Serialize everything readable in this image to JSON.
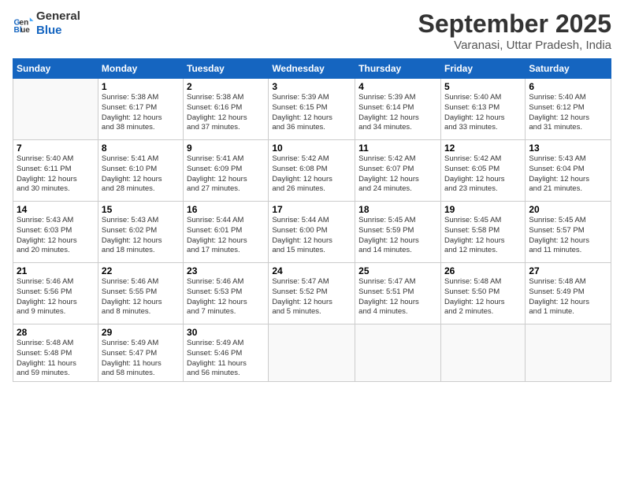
{
  "header": {
    "logo_line1": "General",
    "logo_line2": "Blue",
    "month": "September 2025",
    "location": "Varanasi, Uttar Pradesh, India"
  },
  "days_of_week": [
    "Sunday",
    "Monday",
    "Tuesday",
    "Wednesday",
    "Thursday",
    "Friday",
    "Saturday"
  ],
  "weeks": [
    [
      {
        "num": "",
        "info": ""
      },
      {
        "num": "1",
        "info": "Sunrise: 5:38 AM\nSunset: 6:17 PM\nDaylight: 12 hours\nand 38 minutes."
      },
      {
        "num": "2",
        "info": "Sunrise: 5:38 AM\nSunset: 6:16 PM\nDaylight: 12 hours\nand 37 minutes."
      },
      {
        "num": "3",
        "info": "Sunrise: 5:39 AM\nSunset: 6:15 PM\nDaylight: 12 hours\nand 36 minutes."
      },
      {
        "num": "4",
        "info": "Sunrise: 5:39 AM\nSunset: 6:14 PM\nDaylight: 12 hours\nand 34 minutes."
      },
      {
        "num": "5",
        "info": "Sunrise: 5:40 AM\nSunset: 6:13 PM\nDaylight: 12 hours\nand 33 minutes."
      },
      {
        "num": "6",
        "info": "Sunrise: 5:40 AM\nSunset: 6:12 PM\nDaylight: 12 hours\nand 31 minutes."
      }
    ],
    [
      {
        "num": "7",
        "info": "Sunrise: 5:40 AM\nSunset: 6:11 PM\nDaylight: 12 hours\nand 30 minutes."
      },
      {
        "num": "8",
        "info": "Sunrise: 5:41 AM\nSunset: 6:10 PM\nDaylight: 12 hours\nand 28 minutes."
      },
      {
        "num": "9",
        "info": "Sunrise: 5:41 AM\nSunset: 6:09 PM\nDaylight: 12 hours\nand 27 minutes."
      },
      {
        "num": "10",
        "info": "Sunrise: 5:42 AM\nSunset: 6:08 PM\nDaylight: 12 hours\nand 26 minutes."
      },
      {
        "num": "11",
        "info": "Sunrise: 5:42 AM\nSunset: 6:07 PM\nDaylight: 12 hours\nand 24 minutes."
      },
      {
        "num": "12",
        "info": "Sunrise: 5:42 AM\nSunset: 6:05 PM\nDaylight: 12 hours\nand 23 minutes."
      },
      {
        "num": "13",
        "info": "Sunrise: 5:43 AM\nSunset: 6:04 PM\nDaylight: 12 hours\nand 21 minutes."
      }
    ],
    [
      {
        "num": "14",
        "info": "Sunrise: 5:43 AM\nSunset: 6:03 PM\nDaylight: 12 hours\nand 20 minutes."
      },
      {
        "num": "15",
        "info": "Sunrise: 5:43 AM\nSunset: 6:02 PM\nDaylight: 12 hours\nand 18 minutes."
      },
      {
        "num": "16",
        "info": "Sunrise: 5:44 AM\nSunset: 6:01 PM\nDaylight: 12 hours\nand 17 minutes."
      },
      {
        "num": "17",
        "info": "Sunrise: 5:44 AM\nSunset: 6:00 PM\nDaylight: 12 hours\nand 15 minutes."
      },
      {
        "num": "18",
        "info": "Sunrise: 5:45 AM\nSunset: 5:59 PM\nDaylight: 12 hours\nand 14 minutes."
      },
      {
        "num": "19",
        "info": "Sunrise: 5:45 AM\nSunset: 5:58 PM\nDaylight: 12 hours\nand 12 minutes."
      },
      {
        "num": "20",
        "info": "Sunrise: 5:45 AM\nSunset: 5:57 PM\nDaylight: 12 hours\nand 11 minutes."
      }
    ],
    [
      {
        "num": "21",
        "info": "Sunrise: 5:46 AM\nSunset: 5:56 PM\nDaylight: 12 hours\nand 9 minutes."
      },
      {
        "num": "22",
        "info": "Sunrise: 5:46 AM\nSunset: 5:55 PM\nDaylight: 12 hours\nand 8 minutes."
      },
      {
        "num": "23",
        "info": "Sunrise: 5:46 AM\nSunset: 5:53 PM\nDaylight: 12 hours\nand 7 minutes."
      },
      {
        "num": "24",
        "info": "Sunrise: 5:47 AM\nSunset: 5:52 PM\nDaylight: 12 hours\nand 5 minutes."
      },
      {
        "num": "25",
        "info": "Sunrise: 5:47 AM\nSunset: 5:51 PM\nDaylight: 12 hours\nand 4 minutes."
      },
      {
        "num": "26",
        "info": "Sunrise: 5:48 AM\nSunset: 5:50 PM\nDaylight: 12 hours\nand 2 minutes."
      },
      {
        "num": "27",
        "info": "Sunrise: 5:48 AM\nSunset: 5:49 PM\nDaylight: 12 hours\nand 1 minute."
      }
    ],
    [
      {
        "num": "28",
        "info": "Sunrise: 5:48 AM\nSunset: 5:48 PM\nDaylight: 11 hours\nand 59 minutes."
      },
      {
        "num": "29",
        "info": "Sunrise: 5:49 AM\nSunset: 5:47 PM\nDaylight: 11 hours\nand 58 minutes."
      },
      {
        "num": "30",
        "info": "Sunrise: 5:49 AM\nSunset: 5:46 PM\nDaylight: 11 hours\nand 56 minutes."
      },
      {
        "num": "",
        "info": ""
      },
      {
        "num": "",
        "info": ""
      },
      {
        "num": "",
        "info": ""
      },
      {
        "num": "",
        "info": ""
      }
    ]
  ]
}
